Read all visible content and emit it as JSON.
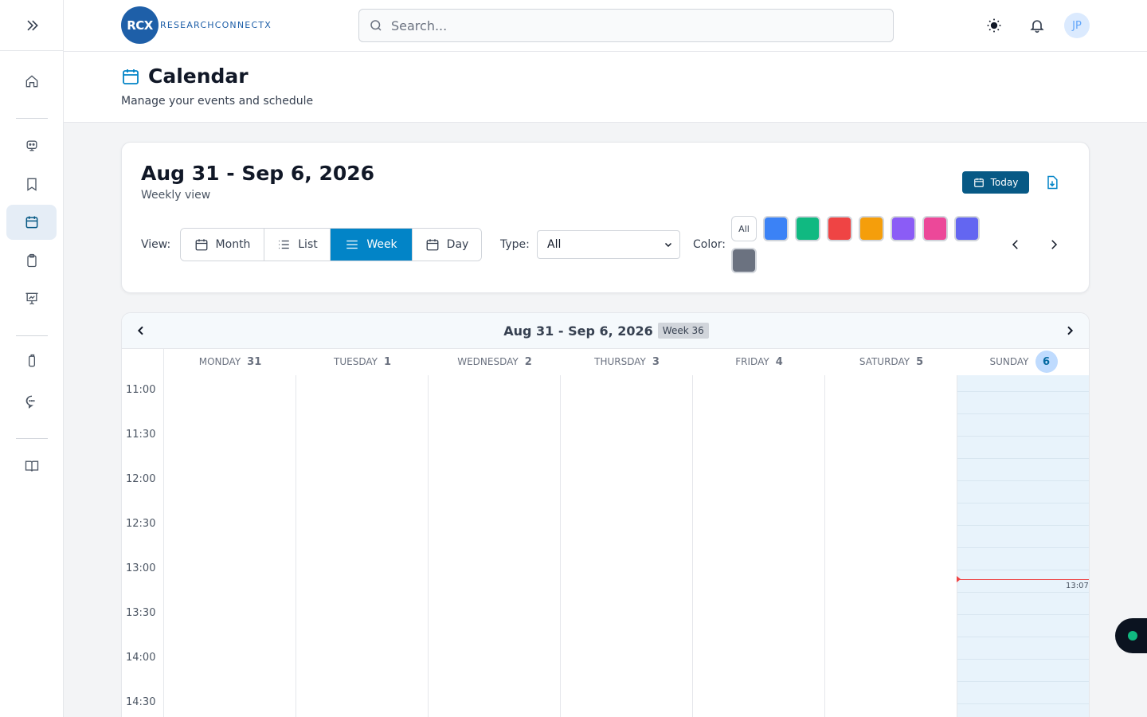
{
  "header": {
    "logo_mark": "RCX",
    "logo_text": "RESEARCHCONNECTX",
    "search_placeholder": "Search...",
    "avatar_initials": "JP"
  },
  "sidebar": {
    "items": [
      {
        "icon": "home-icon"
      },
      {
        "icon": "robot-icon"
      },
      {
        "icon": "bookmark-icon"
      },
      {
        "icon": "calendar-icon",
        "active": true
      },
      {
        "icon": "clipboard-icon"
      },
      {
        "icon": "presentation-icon"
      },
      {
        "icon": "tag-icon"
      },
      {
        "icon": "chat-icon"
      },
      {
        "icon": "book-icon"
      }
    ]
  },
  "page": {
    "title": "Calendar",
    "subtitle": "Manage your events and schedule"
  },
  "controls": {
    "range_title": "Aug 31 - Sep 6, 2026",
    "range_sub": "Weekly view",
    "today_label": "Today",
    "view_label": "View:",
    "views": [
      "Month",
      "List",
      "Week",
      "Day"
    ],
    "active_view": "Week",
    "type_label": "Type:",
    "type_value": "All",
    "color_label": "Color:",
    "color_all": "All",
    "colors": [
      "#3b82f6",
      "#10b981",
      "#ef4444",
      "#f59e0b",
      "#8b5cf6",
      "#ec4899",
      "#6366f1",
      "#6b7280"
    ]
  },
  "calendar": {
    "range": "Aug 31 - Sep 6, 2026",
    "week_badge": "Week 36",
    "days": [
      {
        "name": "MONDAY",
        "num": "31"
      },
      {
        "name": "TUESDAY",
        "num": "1"
      },
      {
        "name": "WEDNESDAY",
        "num": "2"
      },
      {
        "name": "THURSDAY",
        "num": "3"
      },
      {
        "name": "FRIDAY",
        "num": "4"
      },
      {
        "name": "SATURDAY",
        "num": "5"
      },
      {
        "name": "SUNDAY",
        "num": "6",
        "today": true
      }
    ],
    "times": [
      "11:00",
      "11:30",
      "12:00",
      "12:30",
      "13:00",
      "13:30",
      "14:00",
      "14:30"
    ],
    "now_label": "13:07"
  }
}
